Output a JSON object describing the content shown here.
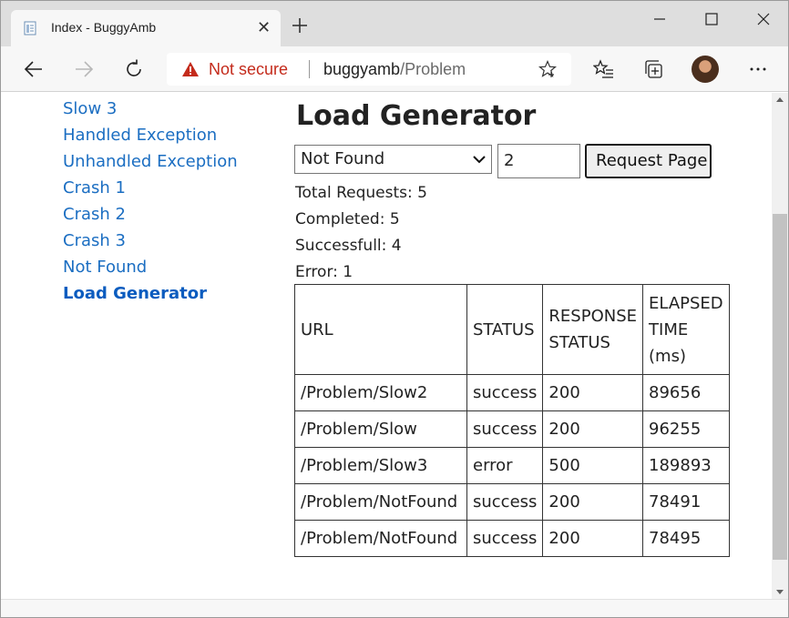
{
  "browser": {
    "tab_title": "Index - BuggyAmb",
    "tab_close": "✕",
    "security_label": "Not secure",
    "url_host": "buggyamb",
    "url_path": "/Problem"
  },
  "nav": {
    "items": [
      {
        "label": "Slow 3"
      },
      {
        "label": "Handled Exception"
      },
      {
        "label": "Unhandled Exception"
      },
      {
        "label": "Crash 1"
      },
      {
        "label": "Crash 2"
      },
      {
        "label": "Crash 3"
      },
      {
        "label": "Not Found"
      },
      {
        "label": "Load Generator"
      }
    ]
  },
  "main": {
    "title": "Load Generator",
    "problem_select": {
      "selected": "Not Found"
    },
    "count_input": {
      "value": "2"
    },
    "request_button": "Request Page",
    "stats": {
      "total": "Total Requests: 5",
      "completed": "Completed: 5",
      "successful": "Successfull: 4",
      "error": "Error: 1"
    },
    "table": {
      "headers": {
        "url": "URL",
        "status": "STATUS",
        "response_1": "RESPONSE",
        "response_2": "STATUS",
        "elapsed_1": "ELAPSED",
        "elapsed_2": "TIME",
        "elapsed_3": "(ms)"
      },
      "rows": [
        {
          "url": "/Problem/Slow2",
          "status": "success",
          "response": "200",
          "elapsed": "89656"
        },
        {
          "url": "/Problem/Slow",
          "status": "success",
          "response": "200",
          "elapsed": "96255"
        },
        {
          "url": "/Problem/Slow3",
          "status": "error",
          "response": "500",
          "elapsed": "189893"
        },
        {
          "url": "/Problem/NotFound",
          "status": "success",
          "response": "200",
          "elapsed": "78491"
        },
        {
          "url": "/Problem/NotFound",
          "status": "success",
          "response": "200",
          "elapsed": "78495"
        }
      ]
    }
  },
  "colors": {
    "link": "#1b6ec2",
    "warning": "#c42b1c"
  },
  "icons": [
    "document-icon",
    "close-icon",
    "plus-icon",
    "minimize-icon",
    "maximize-icon",
    "window-close-icon",
    "back-arrow-icon",
    "forward-arrow-icon",
    "refresh-icon",
    "warning-triangle-icon",
    "favorite-star-icon",
    "favorites-list-icon",
    "collections-icon",
    "more-icon",
    "chevron-down-icon"
  ]
}
